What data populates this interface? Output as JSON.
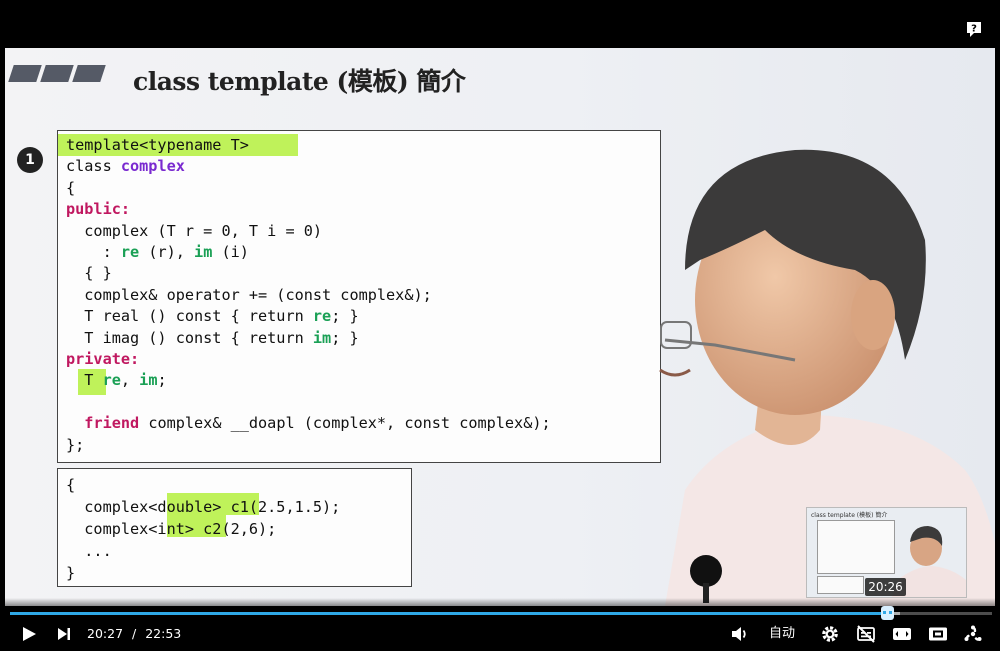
{
  "slide": {
    "title": "class template (模板) 簡介",
    "badge": "1"
  },
  "code_main": {
    "lines": [
      "template<typename T>",
      "class complex",
      "{",
      "public:",
      "  complex (T r = 0, T i = 0)",
      "    : re (r), im (i)",
      "  { }",
      "  complex& operator += (const complex&);",
      "  T real () const { return re; }",
      "  T imag () const { return im; }",
      "private:",
      "  T re, im;",
      "",
      "  friend complex& __doapl (complex*, const complex&);",
      "};"
    ]
  },
  "code_usage": {
    "lines": [
      "{",
      "  complex<double> c1(2.5,1.5);",
      "  complex<int> c2(2,6);",
      "  ...",
      "}"
    ]
  },
  "player": {
    "current_time": "20:27",
    "separator": "/",
    "duration": "22:53",
    "progress_fraction": 0.894,
    "buffered_fraction": 0.906,
    "preview_time": "20:26",
    "quality_label": "自动",
    "accent_color": "#2fa8e6"
  },
  "icons": {
    "help": "help-icon",
    "play": "play-icon",
    "next": "next-icon",
    "volume": "volume-icon",
    "settings": "gear-icon",
    "subtitles": "subtitles-off-icon",
    "theater": "theater-mode-icon",
    "fullscreen": "fullscreen-icon",
    "extra": "extra-icon"
  }
}
